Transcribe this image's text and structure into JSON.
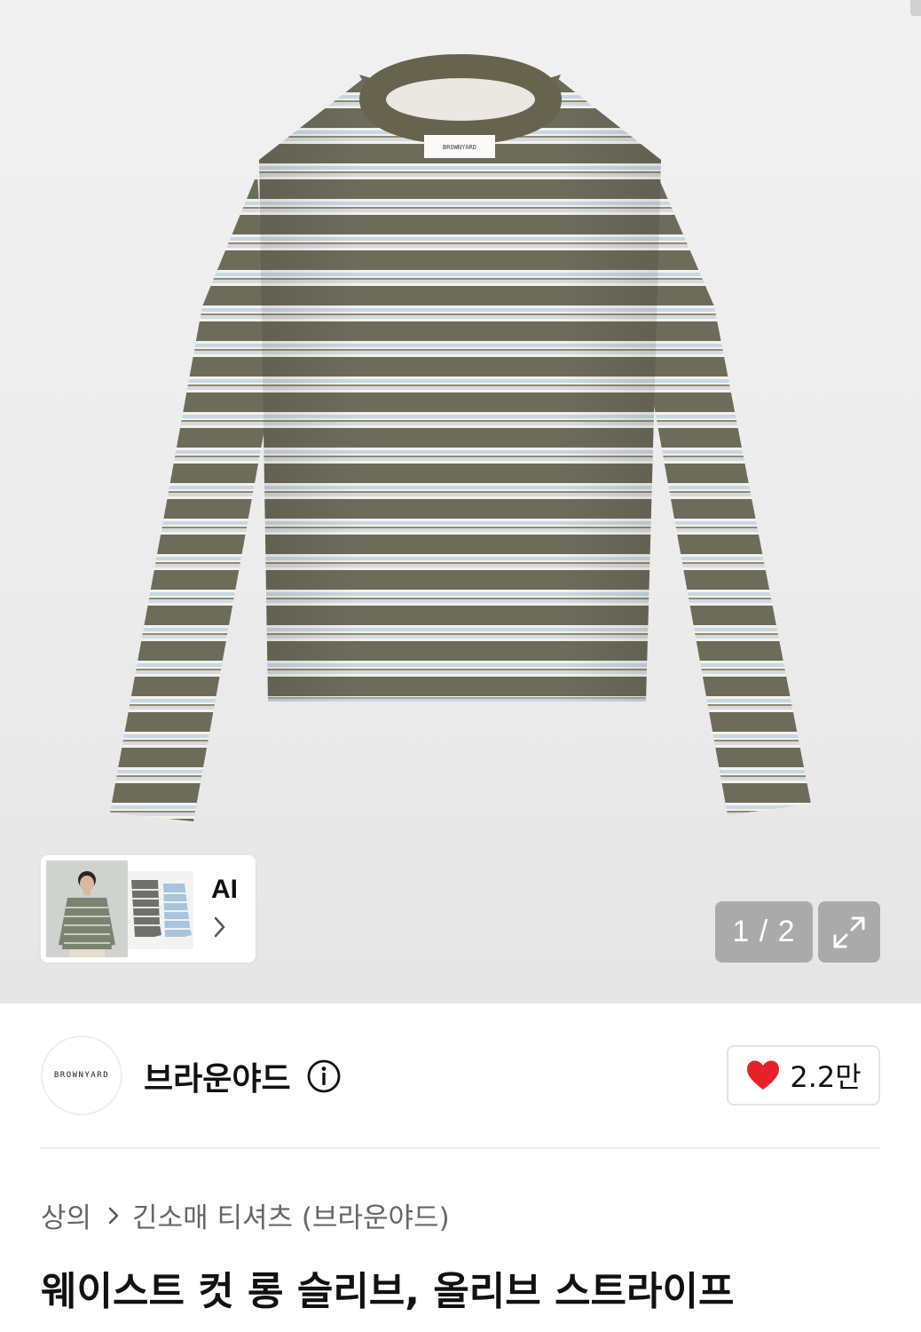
{
  "gallery": {
    "brand_tag": "BROWNYARD",
    "ai_label": "AI",
    "pager_text": "1 / 2",
    "current_page": 1,
    "total_pages": 2
  },
  "brand": {
    "logo_text": "BROWNYARD",
    "name": "브라운야드"
  },
  "like": {
    "count": "2.2만"
  },
  "breadcrumb": {
    "items": [
      "상의",
      "긴소매 티셔츠 (브라운야드)"
    ]
  },
  "product": {
    "title": "웨이스트 컷 롱 슬리브, 올리브 스트라이프"
  },
  "icons": {
    "info": "info-icon",
    "heart": "heart-icon",
    "expand": "expand-icon",
    "chevron": "chevron-right-icon"
  },
  "colors": {
    "heart": "#e8202a",
    "stripe_olive": "#6b6a59",
    "stripe_white": "#f2f1ec",
    "stripe_blue": "#c8d6e2"
  }
}
